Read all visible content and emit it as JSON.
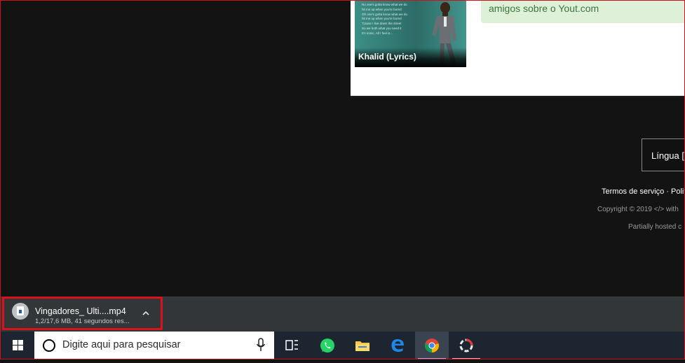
{
  "webpage": {
    "thumbnail_caption": "Khalid (Lyrics)",
    "thumbnail_lyrics": [
      "No one's gotta know what we do",
      "hit me up when you're bored",
      "Oh one's gotta know what we do",
      "hit me up when you're bored",
      "'Cause I live down the street",
      "So we both what you need it",
      "It's ironic, All I feel is..."
    ],
    "notice_text": "amigos sobre o Yout.com",
    "language_label": "Língua [I",
    "footer_terms": "Termos de serviço · Polit",
    "footer_copyright": "Copyright © 2019 </> with",
    "footer_hosted": "Partially hosted c"
  },
  "download_bar": {
    "filename": "Vingadores_  Ulti....mp4",
    "status": "1,2/17,6 MB, 41 segundos res...",
    "chevron_icon": "chevron-up-icon"
  },
  "taskbar": {
    "search_placeholder": "Digite aqui para pesquisar",
    "apps": [
      "windows-start-icon",
      "task-view-icon",
      "whatsapp-icon",
      "file-explorer-icon",
      "edge-icon",
      "chrome-icon",
      "app-icon"
    ]
  },
  "colors": {
    "highlight_red": "#d9121c",
    "notice_green_bg": "#dff0d8",
    "notice_green_text": "#3c763d",
    "taskbar_bg": "#1c2530"
  }
}
